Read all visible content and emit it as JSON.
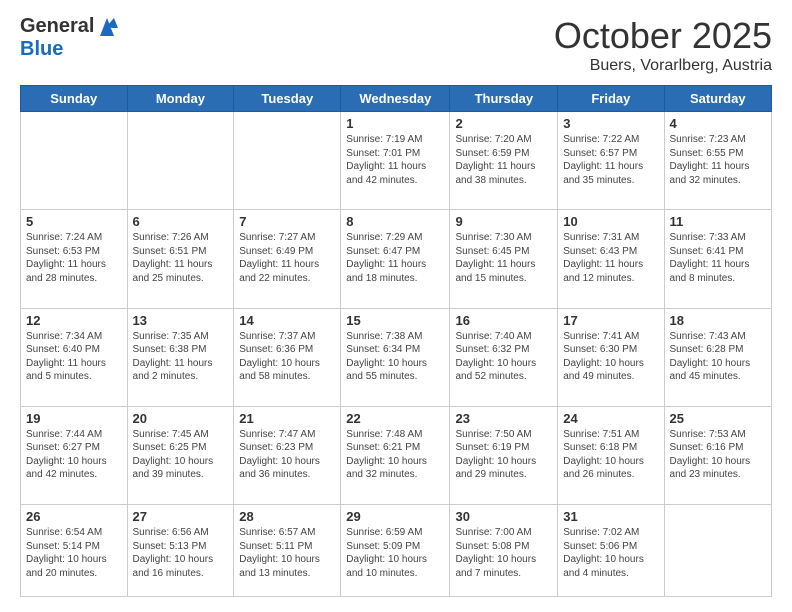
{
  "header": {
    "logo_general": "General",
    "logo_blue": "Blue",
    "month_title": "October 2025",
    "location": "Buers, Vorarlberg, Austria"
  },
  "days_of_week": [
    "Sunday",
    "Monday",
    "Tuesday",
    "Wednesday",
    "Thursday",
    "Friday",
    "Saturday"
  ],
  "weeks": [
    [
      {
        "day": "",
        "info": ""
      },
      {
        "day": "",
        "info": ""
      },
      {
        "day": "",
        "info": ""
      },
      {
        "day": "1",
        "info": "Sunrise: 7:19 AM\nSunset: 7:01 PM\nDaylight: 11 hours and 42 minutes."
      },
      {
        "day": "2",
        "info": "Sunrise: 7:20 AM\nSunset: 6:59 PM\nDaylight: 11 hours and 38 minutes."
      },
      {
        "day": "3",
        "info": "Sunrise: 7:22 AM\nSunset: 6:57 PM\nDaylight: 11 hours and 35 minutes."
      },
      {
        "day": "4",
        "info": "Sunrise: 7:23 AM\nSunset: 6:55 PM\nDaylight: 11 hours and 32 minutes."
      }
    ],
    [
      {
        "day": "5",
        "info": "Sunrise: 7:24 AM\nSunset: 6:53 PM\nDaylight: 11 hours and 28 minutes."
      },
      {
        "day": "6",
        "info": "Sunrise: 7:26 AM\nSunset: 6:51 PM\nDaylight: 11 hours and 25 minutes."
      },
      {
        "day": "7",
        "info": "Sunrise: 7:27 AM\nSunset: 6:49 PM\nDaylight: 11 hours and 22 minutes."
      },
      {
        "day": "8",
        "info": "Sunrise: 7:29 AM\nSunset: 6:47 PM\nDaylight: 11 hours and 18 minutes."
      },
      {
        "day": "9",
        "info": "Sunrise: 7:30 AM\nSunset: 6:45 PM\nDaylight: 11 hours and 15 minutes."
      },
      {
        "day": "10",
        "info": "Sunrise: 7:31 AM\nSunset: 6:43 PM\nDaylight: 11 hours and 12 minutes."
      },
      {
        "day": "11",
        "info": "Sunrise: 7:33 AM\nSunset: 6:41 PM\nDaylight: 11 hours and 8 minutes."
      }
    ],
    [
      {
        "day": "12",
        "info": "Sunrise: 7:34 AM\nSunset: 6:40 PM\nDaylight: 11 hours and 5 minutes."
      },
      {
        "day": "13",
        "info": "Sunrise: 7:35 AM\nSunset: 6:38 PM\nDaylight: 11 hours and 2 minutes."
      },
      {
        "day": "14",
        "info": "Sunrise: 7:37 AM\nSunset: 6:36 PM\nDaylight: 10 hours and 58 minutes."
      },
      {
        "day": "15",
        "info": "Sunrise: 7:38 AM\nSunset: 6:34 PM\nDaylight: 10 hours and 55 minutes."
      },
      {
        "day": "16",
        "info": "Sunrise: 7:40 AM\nSunset: 6:32 PM\nDaylight: 10 hours and 52 minutes."
      },
      {
        "day": "17",
        "info": "Sunrise: 7:41 AM\nSunset: 6:30 PM\nDaylight: 10 hours and 49 minutes."
      },
      {
        "day": "18",
        "info": "Sunrise: 7:43 AM\nSunset: 6:28 PM\nDaylight: 10 hours and 45 minutes."
      }
    ],
    [
      {
        "day": "19",
        "info": "Sunrise: 7:44 AM\nSunset: 6:27 PM\nDaylight: 10 hours and 42 minutes."
      },
      {
        "day": "20",
        "info": "Sunrise: 7:45 AM\nSunset: 6:25 PM\nDaylight: 10 hours and 39 minutes."
      },
      {
        "day": "21",
        "info": "Sunrise: 7:47 AM\nSunset: 6:23 PM\nDaylight: 10 hours and 36 minutes."
      },
      {
        "day": "22",
        "info": "Sunrise: 7:48 AM\nSunset: 6:21 PM\nDaylight: 10 hours and 32 minutes."
      },
      {
        "day": "23",
        "info": "Sunrise: 7:50 AM\nSunset: 6:19 PM\nDaylight: 10 hours and 29 minutes."
      },
      {
        "day": "24",
        "info": "Sunrise: 7:51 AM\nSunset: 6:18 PM\nDaylight: 10 hours and 26 minutes."
      },
      {
        "day": "25",
        "info": "Sunrise: 7:53 AM\nSunset: 6:16 PM\nDaylight: 10 hours and 23 minutes."
      }
    ],
    [
      {
        "day": "26",
        "info": "Sunrise: 6:54 AM\nSunset: 5:14 PM\nDaylight: 10 hours and 20 minutes."
      },
      {
        "day": "27",
        "info": "Sunrise: 6:56 AM\nSunset: 5:13 PM\nDaylight: 10 hours and 16 minutes."
      },
      {
        "day": "28",
        "info": "Sunrise: 6:57 AM\nSunset: 5:11 PM\nDaylight: 10 hours and 13 minutes."
      },
      {
        "day": "29",
        "info": "Sunrise: 6:59 AM\nSunset: 5:09 PM\nDaylight: 10 hours and 10 minutes."
      },
      {
        "day": "30",
        "info": "Sunrise: 7:00 AM\nSunset: 5:08 PM\nDaylight: 10 hours and 7 minutes."
      },
      {
        "day": "31",
        "info": "Sunrise: 7:02 AM\nSunset: 5:06 PM\nDaylight: 10 hours and 4 minutes."
      },
      {
        "day": "",
        "info": ""
      }
    ]
  ]
}
